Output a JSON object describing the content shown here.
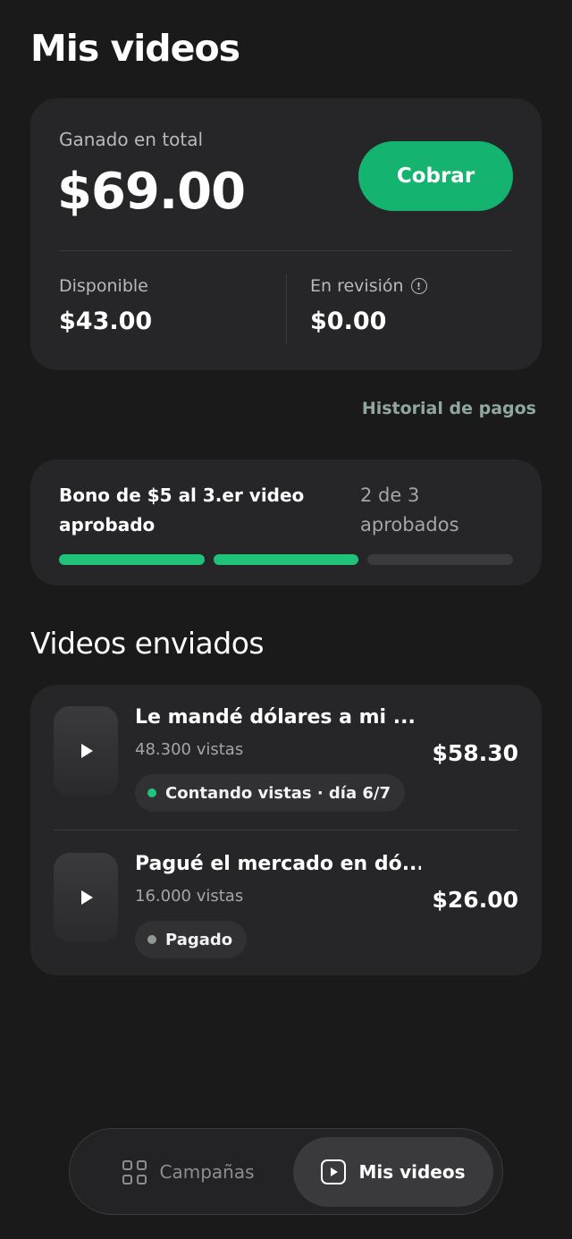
{
  "header": {
    "title": "Mis videos"
  },
  "earnings": {
    "label": "Ganado en total",
    "total": "$69.00",
    "cta_label": "Cobrar",
    "available_label": "Disponible",
    "available_value": "$43.00",
    "review_label": "En revisión",
    "review_value": "$0.00",
    "review_info_icon": "info-circle-icon"
  },
  "history_link": "Historial de pagos",
  "bonus": {
    "title": "Bono de $5 al 3.er video aprobado",
    "count": "2 de 3 aprobados",
    "approved": 2,
    "required": 3
  },
  "videos_section": {
    "title": "Videos enviados",
    "items": [
      {
        "title": "Le mandé dólares a mi ...",
        "views": "48.300 vistas",
        "status": "Contando vistas · día 6/7",
        "status_color": "#1fc47a",
        "amount": "$58.30"
      },
      {
        "title": "Pagué el mercado en dó...",
        "views": "16.000 vistas",
        "status": "Pagado",
        "status_color": "#8f9a94",
        "amount": "$26.00"
      }
    ]
  },
  "nav": {
    "items": [
      {
        "label": "Campañas",
        "icon": "grid-icon",
        "active": false
      },
      {
        "label": "Mis videos",
        "icon": "video-play-icon",
        "active": true
      }
    ]
  },
  "colors": {
    "background": "#1a1a1a",
    "card": "#262628",
    "accent": "#14b36f",
    "progress_done": "#1fc47a",
    "link": "#8fa79c"
  }
}
